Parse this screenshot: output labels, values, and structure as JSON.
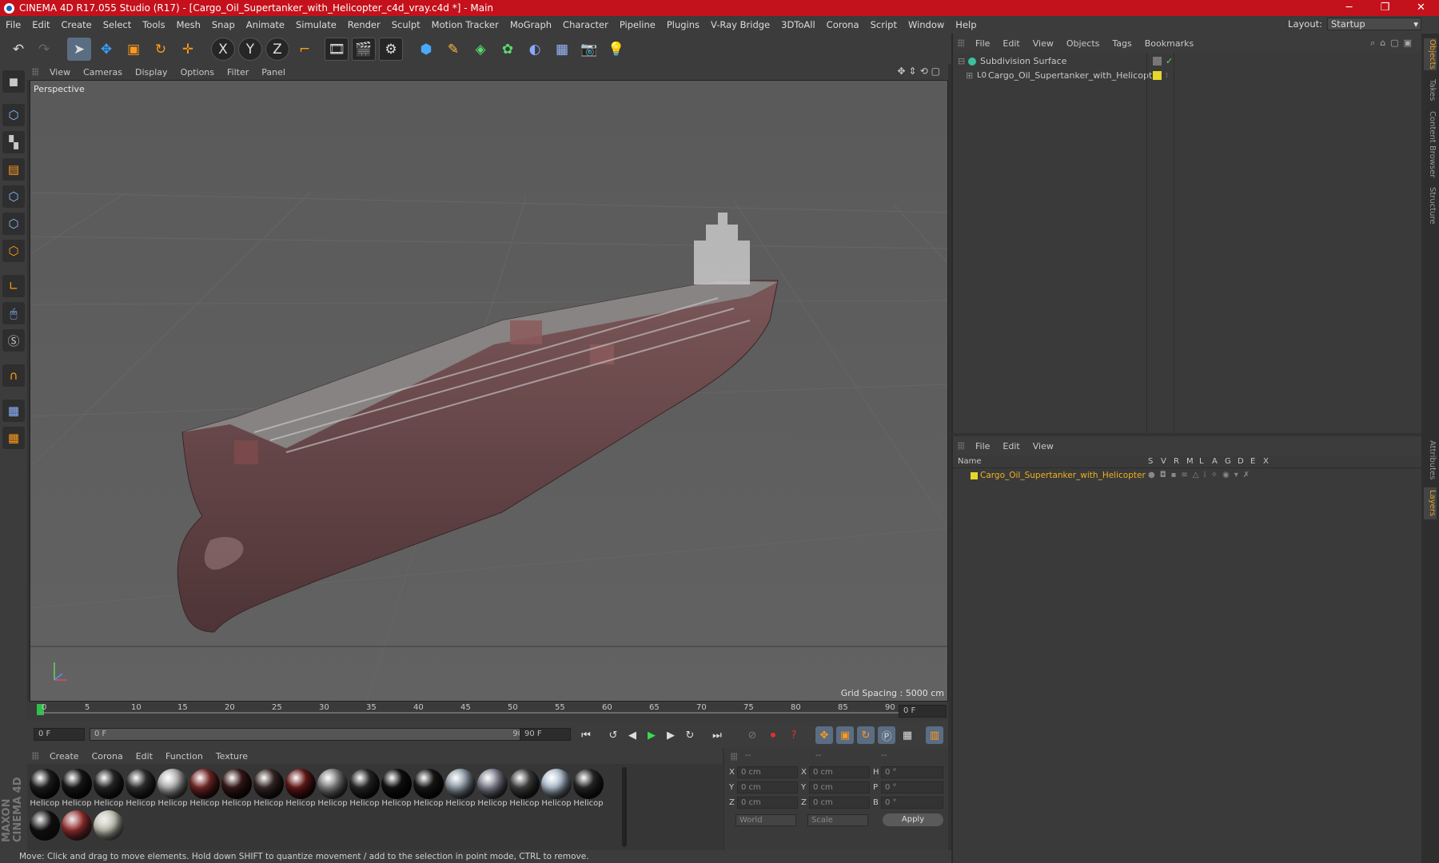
{
  "window": {
    "title": "CINEMA 4D R17.055 Studio (R17) - [Cargo_Oil_Supertanker_with_Helicopter_c4d_vray.c4d *] - Main"
  },
  "menubar": {
    "items": [
      "File",
      "Edit",
      "Create",
      "Select",
      "Tools",
      "Mesh",
      "Snap",
      "Animate",
      "Simulate",
      "Render",
      "Sculpt",
      "Motion Tracker",
      "MoGraph",
      "Character",
      "Pipeline",
      "Plugins",
      "V-Ray Bridge",
      "3DToAll",
      "Corona",
      "Script",
      "Window",
      "Help"
    ],
    "layout_label": "Layout:",
    "layout_value": "Startup"
  },
  "toolbar": {
    "icons": [
      "undo-icon",
      "redo-icon",
      "select-arrow-icon",
      "move-icon",
      "scale-icon",
      "rotate-icon",
      "live-select-icon",
      "x-axis-icon",
      "y-axis-icon",
      "z-axis-icon",
      "world-coord-icon",
      "render-view-icon",
      "render-picture-icon",
      "render-settings-icon",
      "cube-primitive-icon",
      "pen-spline-icon",
      "subdivision-icon",
      "array-icon",
      "deformer-icon",
      "floor-icon",
      "camera-icon",
      "light-icon"
    ],
    "axis_x": "X",
    "axis_y": "Y",
    "axis_z": "Z"
  },
  "viewport": {
    "menu": [
      "View",
      "Cameras",
      "Display",
      "Options",
      "Filter",
      "Panel"
    ],
    "label": "Perspective",
    "grid_spacing": "Grid Spacing : 5000 cm"
  },
  "timeline": {
    "ticks": [
      "0",
      "5",
      "10",
      "15",
      "20",
      "25",
      "30",
      "35",
      "40",
      "45",
      "50",
      "55",
      "60",
      "65",
      "70",
      "75",
      "80",
      "85",
      "90"
    ],
    "current_frame": "0 F",
    "start_field": "0 F",
    "range_start": "0 F",
    "range_end": "90 F",
    "end_field": "90 F"
  },
  "materials": {
    "menu": [
      "Create",
      "Corona",
      "Edit",
      "Function",
      "Texture"
    ],
    "label": "Helicop",
    "count_row1": 18,
    "count_row2": 3
  },
  "coords": {
    "headers": [
      "--",
      "--",
      "--"
    ],
    "rows": [
      {
        "a": "X",
        "av": "0 cm",
        "b": "X",
        "bv": "0 cm",
        "c": "H",
        "cv": "0 °"
      },
      {
        "a": "Y",
        "av": "0 cm",
        "b": "Y",
        "bv": "0 cm",
        "c": "P",
        "cv": "0 °"
      },
      {
        "a": "Z",
        "av": "0 cm",
        "b": "Z",
        "bv": "0 cm",
        "c": "B",
        "cv": "0 °"
      }
    ],
    "mode": "World",
    "scale": "Scale",
    "apply": "Apply"
  },
  "objects": {
    "menu": [
      "File",
      "Edit",
      "View",
      "Objects",
      "Tags",
      "Bookmarks"
    ],
    "items": [
      {
        "name": "Subdivision Surface"
      },
      {
        "name": "Cargo_Oil_Supertanker_with_Helicopter"
      }
    ]
  },
  "layers": {
    "menu": [
      "File",
      "Edit",
      "View"
    ],
    "col_name": "Name",
    "cols": [
      "S",
      "V",
      "R",
      "M",
      "L",
      "A",
      "G",
      "D",
      "E",
      "X"
    ],
    "row": "Cargo_Oil_Supertanker_with_Helicopter"
  },
  "right_tabs": [
    "Objects",
    "Takes",
    "Content Browser",
    "Structure",
    "Attributes",
    "Layers"
  ],
  "status": "Move: Click and drag to move elements. Hold down SHIFT to quantize movement / add to the selection in point mode, CTRL to remove.",
  "brand": "MAXON CINEMA 4D",
  "colors": {
    "title_bar": "#c4111b",
    "accent": "#ffb800",
    "hull": "#6a4a4c"
  }
}
